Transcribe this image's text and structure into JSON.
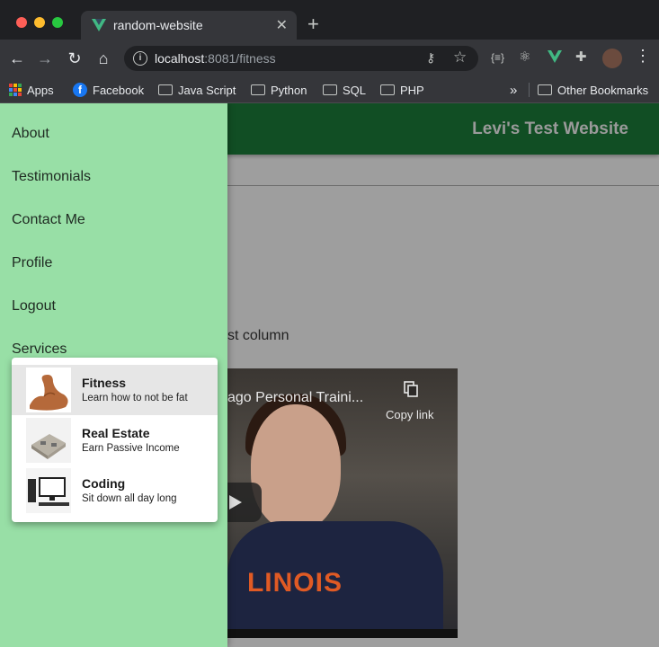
{
  "browser": {
    "tab_title": "random-website",
    "tab_close": "✕",
    "new_tab": "+",
    "url_host": "localhost",
    "url_rest": ":8081/fitness",
    "bookmarks": [
      "Apps",
      "Facebook",
      "Java Script",
      "Python",
      "SQL",
      "PHP"
    ],
    "bookmarks_overflow": "»",
    "other_bookmarks": "Other Bookmarks"
  },
  "header": {
    "title": "Levi's Test Website"
  },
  "drawer": {
    "items": [
      "About",
      "Testimonials",
      "Contact Me",
      "Profile",
      "Logout",
      "Services"
    ]
  },
  "services_menu": {
    "items": [
      {
        "title": "Fitness",
        "subtitle": "Learn how to not be fat",
        "icon": "flexed-arm-icon",
        "active": true
      },
      {
        "title": "Real Estate",
        "subtitle": "Earn Passive Income",
        "icon": "house-icon",
        "active": false
      },
      {
        "title": "Coding",
        "subtitle": "Sit down all day long",
        "icon": "computer-icon",
        "active": false
      }
    ]
  },
  "main": {
    "column_text": "st column",
    "video": {
      "title": "ago Personal Traini...",
      "copy_link": "Copy link",
      "shirt_text": "LINOIS"
    }
  },
  "colors": {
    "appbar": "#114e24",
    "drawer": "#98dfa6",
    "vue_green": "#41b883"
  }
}
